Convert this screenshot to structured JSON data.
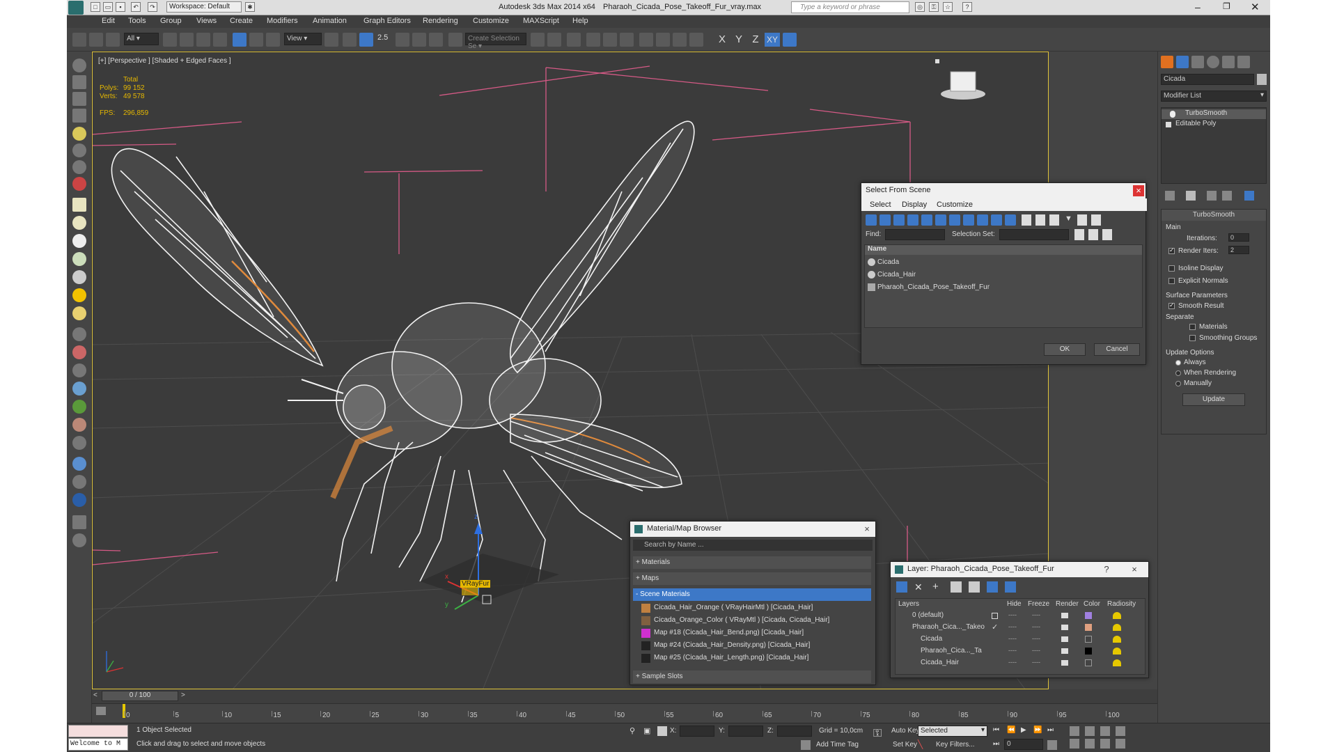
{
  "window": {
    "workspace": "Workspace: Default",
    "title": "Autodesk 3ds Max  2014 x64",
    "file": "Pharaoh_Cicada_Pose_Takeoff_Fur_vray.max",
    "search_placeholder": "Type a keyword or phrase"
  },
  "menu": [
    "Edit",
    "Tools",
    "Group",
    "Views",
    "Create",
    "Modifiers",
    "Animation",
    "Graph Editors",
    "Rendering",
    "Customize",
    "MAXScript",
    "Help"
  ],
  "toolbar": {
    "filter": "All",
    "refcoord": "View",
    "snap_angle": "2.5",
    "named_sel": "Create Selection Se",
    "axes": [
      "X",
      "Y",
      "Z",
      "XY"
    ]
  },
  "viewport": {
    "label": "[+] [Perspective ] [Shaded + Edged Faces ]",
    "stats_total": "Total",
    "polys_label": "Polys:",
    "polys": "99 152",
    "verts_label": "Verts:",
    "verts": "49 578",
    "fps_label": "FPS:",
    "fps": "296,859",
    "gizmo_label": "VRayFur",
    "axis_x": "x",
    "axis_y": "y",
    "axis_z": "z"
  },
  "command_panel": {
    "object_name": "Cicada",
    "modifier_list": "Modifier List",
    "stack": [
      "TurboSmooth",
      "Editable Poly"
    ],
    "rollout": "TurboSmooth",
    "main": "Main",
    "iterations_label": "Iterations:",
    "iterations": "0",
    "render_iters_label": "Render Iters:",
    "render_iters": "2",
    "isoline": "Isoline Display",
    "explicit": "Explicit Normals",
    "surface": "Surface Parameters",
    "smooth_result": "Smooth Result",
    "separate": "Separate",
    "materials": "Materials",
    "smoothing_groups": "Smoothing Groups",
    "update_options": "Update Options",
    "always": "Always",
    "when_rendering": "When Rendering",
    "manually": "Manually",
    "update": "Update"
  },
  "select_dialog": {
    "title": "Select From Scene",
    "menu": [
      "Select",
      "Display",
      "Customize"
    ],
    "find_label": "Find:",
    "selset_label": "Selection Set:",
    "column": "Name",
    "items": [
      "Cicada",
      "Cicada_Hair",
      "Pharaoh_Cicada_Pose_Takeoff_Fur"
    ],
    "ok": "OK",
    "cancel": "Cancel"
  },
  "material_browser": {
    "title": "Material/Map Browser",
    "search_placeholder": "Search by Name ...",
    "groups": [
      "+ Materials",
      "+ Maps",
      "- Scene Materials"
    ],
    "items": [
      "Cicada_Hair_Orange  ( VRayHairMtl ) [Cicada_Hair]",
      "Cicada_Orange_Color  ( VRayMtl ) [Cicada, Cicada_Hair]",
      "Map #18 (Cicada_Hair_Bend.png) [Cicada_Hair]",
      "Map #24 (Cicada_Hair_Density.png) [Cicada_Hair]",
      "Map #25 (Cicada_Hair_Length.png) [Cicada_Hair]"
    ],
    "sample_slots": "+ Sample Slots"
  },
  "layer_dialog": {
    "title": "Layer: Pharaoh_Cicada_Pose_Takeoff_Fur",
    "help": "?",
    "columns": [
      "Layers",
      "Hide",
      "Freeze",
      "Render",
      "Color",
      "Radiosity"
    ],
    "rows": [
      "0 (default)",
      "Pharaoh_Cica..._Takeo",
      "Cicada",
      "Pharaoh_Cica..._Ta",
      "Cicada_Hair"
    ],
    "dots": "----",
    "swatches": [
      "#a080e0",
      "#e0a080",
      "#444444",
      "#000000",
      "#444444"
    ]
  },
  "timeline": {
    "frame": "0 / 100",
    "ticks": [
      "0",
      "5",
      "10",
      "15",
      "20",
      "25",
      "30",
      "35",
      "40",
      "45",
      "50",
      "55",
      "60",
      "65",
      "70",
      "75",
      "80",
      "85",
      "90",
      "95",
      "100"
    ]
  },
  "status": {
    "maxscript": "Welcome to M",
    "selected": "1 Object Selected",
    "prompt": "Click and drag to select and move objects",
    "x_label": "X:",
    "y_label": "Y:",
    "z_label": "Z:",
    "grid": "Grid = 10,0cm",
    "add_time_tag": "Add Time Tag",
    "auto_key": "Auto Key",
    "set_key": "Set Key",
    "selected_mode": "Selected",
    "key_filters": "Key Filters...",
    "frame_field": "0"
  },
  "colors": {
    "wireframe": "#f2f2f2",
    "orange": "#e08a3c",
    "grid_pink": "#d65a86",
    "highlight": "#3d78c7",
    "stats": "#e6b800"
  }
}
